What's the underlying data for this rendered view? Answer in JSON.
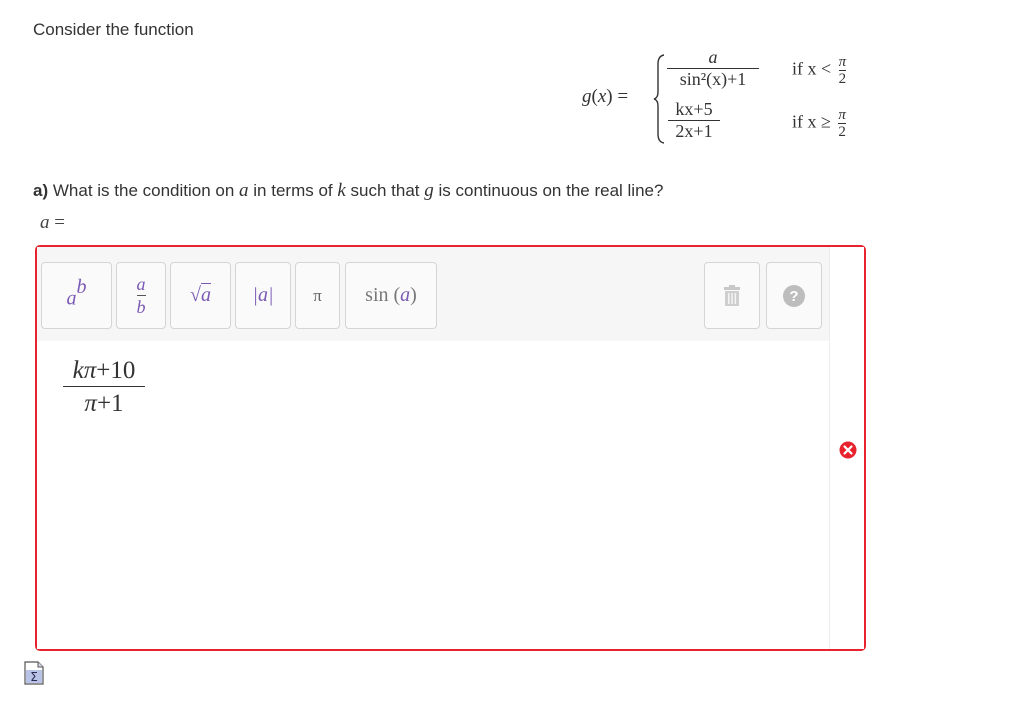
{
  "intro": "Consider the function",
  "function": {
    "lhs": "g(x) =",
    "case1": {
      "num": "a",
      "den": "sin²(x)+1",
      "cond_prefix": "if x <",
      "cond_num": "π",
      "cond_den": "2"
    },
    "case2": {
      "num": "kx+5",
      "den": "2x+1",
      "cond_prefix": "if x ≥",
      "cond_num": "π",
      "cond_den": "2"
    }
  },
  "question": {
    "part": "a)",
    "text_before": "What is the condition on",
    "var_a": "a",
    "text_mid": "in terms of",
    "var_k": "k",
    "text_mid2": "such that",
    "var_g": "g",
    "text_after": "is continuous on the real line?"
  },
  "answer_label": "a =",
  "toolbar": {
    "power": {
      "base": "a",
      "exp": "b"
    },
    "fraction": {
      "num": "a",
      "den": "b"
    },
    "sqrt": {
      "symbol": "√",
      "arg": "a"
    },
    "abs": "|a|",
    "pi": "π",
    "sin": {
      "fn": "sin",
      "arg": "a"
    },
    "delete_icon": "trash-icon",
    "help_icon": "help-icon",
    "help_glyph": "?"
  },
  "answer": {
    "num": "kπ+10",
    "den": "π+1"
  },
  "status": {
    "icon": "error-icon",
    "color": "#e8232d"
  },
  "colors": {
    "border": "#e8232d",
    "button_purple": "#7a5ab5"
  },
  "sigma_icon": "equation-editor-icon"
}
